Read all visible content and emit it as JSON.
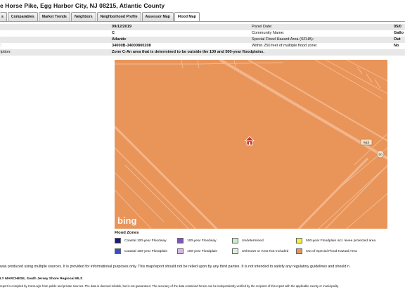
{
  "header": {
    "title": "e Horse Pike, Egg Harbor City, NJ 08215, Atlantic County"
  },
  "tabs": [
    {
      "label": "s"
    },
    {
      "label": "Comparables"
    },
    {
      "label": "Market Trends"
    },
    {
      "label": "Neighbors"
    },
    {
      "label": "Neighborhood Profile"
    },
    {
      "label": "Assessor Map"
    },
    {
      "label": "Flood Map"
    }
  ],
  "info_rows": [
    {
      "label": ":",
      "value": "09/12/2019",
      "label2": "Panel Date:",
      "value2": "05/0"
    },
    {
      "label": ":",
      "value": "C",
      "label2": "Community Name:",
      "value2": "Gallo"
    },
    {
      "label": "",
      "value": "Atlantic",
      "label2": "Special Flood Hazard Area (SFHA):",
      "value2": "Out"
    },
    {
      "label": "l:",
      "value": "34000B-34000800208",
      "label2": "Within 250 feet of multiple flood zone:",
      "value2": "No"
    },
    {
      "label": "ription:",
      "value": "Zone C-An area that is determined to be outside the 100 and 500-year floodplains.",
      "label2": "",
      "value2": ""
    }
  ],
  "map": {
    "logo": "bing",
    "route_labels": [
      "563",
      "50"
    ],
    "marker": "house-marker-icon",
    "fill_color": "#e9955a",
    "road_color": "#f2b68c"
  },
  "legend": {
    "title": "Flood Zones",
    "items": [
      {
        "label": "Coastal 100-year Floodway",
        "color": "#1a1a7a"
      },
      {
        "label": "100-year Floodway",
        "color": "#7d55b8"
      },
      {
        "label": "Undetermined",
        "color": "#c8f0c8"
      },
      {
        "label": "500-year Floodplain incl. levee protected area",
        "color": "#f2f238"
      },
      {
        "label": "Coastal 100-year Floodplain",
        "color": "#2f4fd8"
      },
      {
        "label": "100-year Floodplain",
        "color": "#d6b6e6"
      },
      {
        "label": "Unknown or Area Not Included",
        "color": "#d8f4d8"
      },
      {
        "label": "Out of Special Flood Hazard Area",
        "color": "#e9955a"
      }
    ]
  },
  "disclaimer": "was produced using multiple sources.  It is provided for informational purposes only.  This map/report should not be relied upon by any third parties.  It is not intended to satisfy any regulatory guidelines and should n",
  "footer": {
    "agent": "LY MARCHESE, South Jersey Shore Regional MLS",
    "note": "report is compiled by CoreLogic from public and private sources. The data is deemed reliable, but is not guaranteed. The accuracy of the data contained herein can be independently verified by the recipient of this report with the applicable county or municipality."
  }
}
